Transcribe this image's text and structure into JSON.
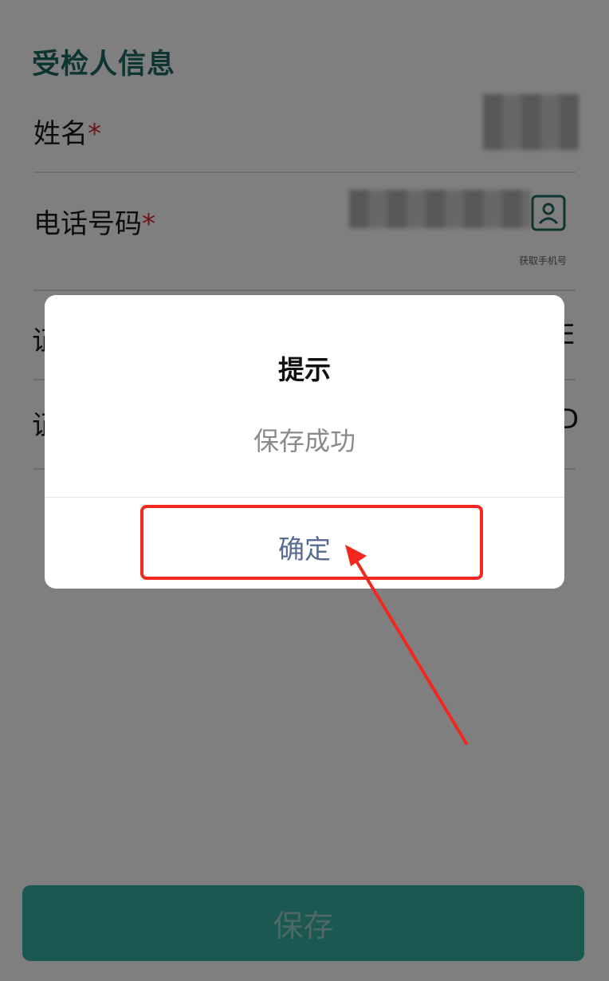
{
  "form": {
    "section_title": "受检人信息",
    "name_label": "姓名",
    "phone_label": "电话号码",
    "required_mark": "*",
    "contact_caption": "获取手机号",
    "row3_clip_left": "证",
    "row3_clip_right": "E",
    "row4_clip_left": "证",
    "row4_clip_right": "D"
  },
  "save_button": {
    "label": "保存"
  },
  "dialog": {
    "title": "提示",
    "message": "保存成功",
    "confirm_label": "确定"
  },
  "colors": {
    "accent": "#1f6b65",
    "save_bar": "#37b1a5",
    "required": "#d62d2d",
    "confirm_text": "#586c94",
    "annotation": "#f2271f"
  }
}
